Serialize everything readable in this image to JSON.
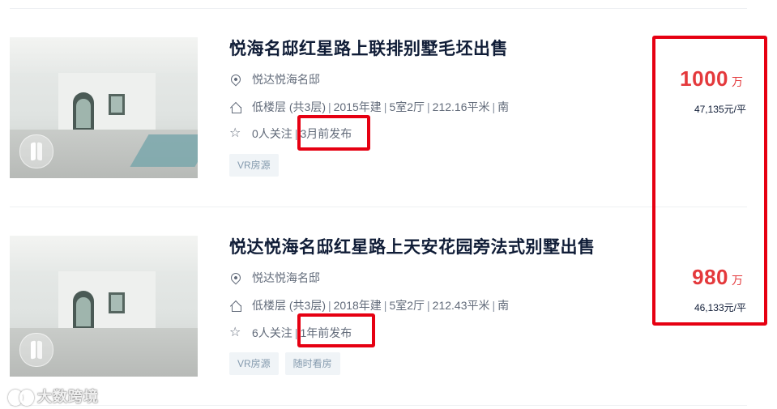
{
  "listings": [
    {
      "title": "悦海名邸红星路上联排别墅毛坯出售",
      "community": "悦达悦海名邸",
      "floor": "低楼层 (共3层)",
      "year": "2015年建",
      "layout": "5室2厅",
      "area": "212.16平米",
      "orientation": "南",
      "followers": "0人关注",
      "published": "3月前发布",
      "tags": [
        "VR房源"
      ],
      "price_total": "1000",
      "price_unit_label": "万",
      "unit_price": "47,135元/平"
    },
    {
      "title": "悦达悦海名邸红星路上天安花园旁法式别墅出售",
      "community": "悦达悦海名邸",
      "floor": "低楼层 (共3层)",
      "year": "2018年建",
      "layout": "5室2厅",
      "area": "212.43平米",
      "orientation": "南",
      "followers": "6人关注",
      "published": "1年前发布",
      "tags": [
        "VR房源",
        "随时看房"
      ],
      "price_total": "980",
      "price_unit_label": "万",
      "unit_price": "46,133元/平"
    }
  ],
  "separator": "|",
  "watermark": "大数跨境",
  "colors": {
    "price": "#e4393c",
    "highlight_box": "#e60012",
    "title": "#101d37",
    "meta": "#626b7a",
    "tag_bg": "#f0f4f7",
    "tag_text": "#849aae"
  },
  "icons": [
    "location-pin-icon",
    "house-icon",
    "star-icon",
    "vr-icon"
  ]
}
